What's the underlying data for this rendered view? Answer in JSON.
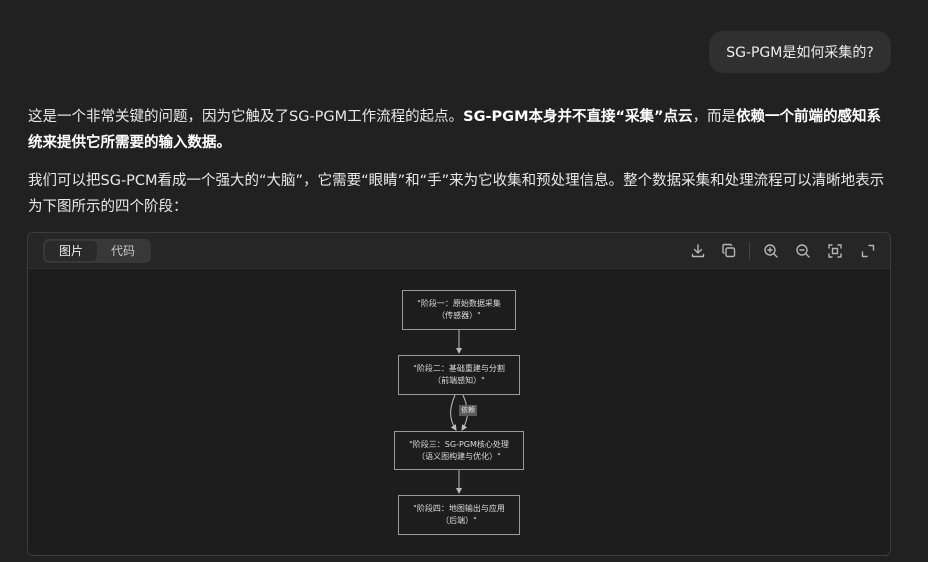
{
  "user_message": "SG-PGM是如何采集的?",
  "answer": {
    "p1_a": "这是一个非常关键的问题，因为它触及了SG-PGM工作流程的起点。",
    "p1_b": "SG-PGM本身并不直接“采集”点云",
    "p1_c": "，而是",
    "p1_d": "依赖一个前端的感知系统来提供它所需要的输入数据。",
    "p2": "我们可以把SG-PCM看成一个强大的“大脑”，它需要“眼睛”和“手”来为它收集和预处理信息。整个数据采集和处理流程可以清晰地表示为下图所示的四个阶段："
  },
  "viewer": {
    "tabs": [
      "图片",
      "代码"
    ],
    "active_tab": "图片",
    "tools": [
      "download-icon",
      "copy-icon",
      "zoom-in-icon",
      "zoom-out-icon",
      "fit-screen-icon",
      "fullscreen-icon"
    ]
  },
  "diagram": {
    "nodes": [
      {
        "line1": "\"阶段一：原始数据采集",
        "line2": "（传感器）\""
      },
      {
        "line1": "\"阶段二：基础重建与分割",
        "line2": "（前端感知）\""
      },
      {
        "line1": "\"阶段三：SG-PGM核心处理",
        "line2": "（语义图构建与优化）\""
      },
      {
        "line1": "\"阶段四：地图输出与应用",
        "line2": "（后端）\""
      }
    ],
    "edge_label": "依赖"
  },
  "colors": {
    "background": "#212121",
    "bubble": "#303030",
    "viewer_bar": "#262626",
    "node_border": "#9a9a9a"
  }
}
